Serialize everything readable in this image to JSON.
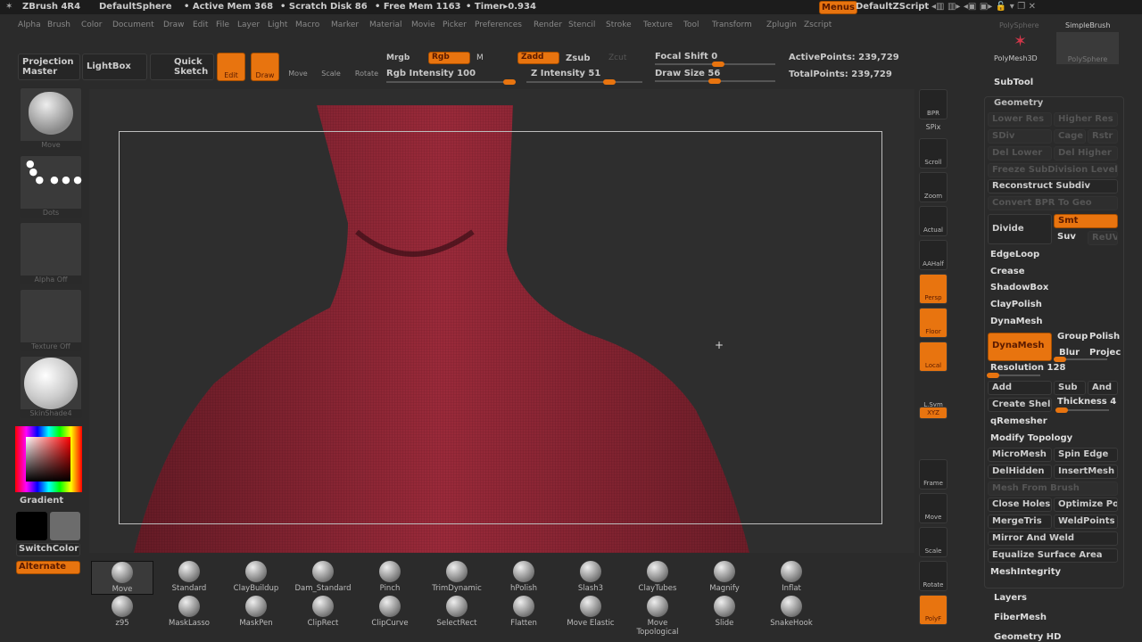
{
  "title": {
    "app": "ZBrush 4R4",
    "doc": "DefaultSphere",
    "active_mem": "• Active Mem 368",
    "scratch": "• Scratch Disk 86",
    "free_mem": "• Free Mem 1163",
    "timer": "• Timer▸0.934",
    "menus": "Menus",
    "script": "DefaultZScript"
  },
  "menu": [
    "Alpha",
    "Brush",
    "Color",
    "Document",
    "Draw",
    "Edit",
    "File",
    "Layer",
    "Light",
    "Macro",
    "Marker",
    "Material",
    "Movie",
    "Picker",
    "Preferences",
    "Render",
    "Stencil",
    "Stroke",
    "Texture",
    "Tool",
    "Transform",
    "Zplugin",
    "Zscript"
  ],
  "toolbar": {
    "projection_master": "Projection Master",
    "lightbox": "LightBox",
    "quick_sketch": "Quick Sketch",
    "edit": "Edit",
    "draw": "Draw",
    "move": "Move",
    "scale": "Scale",
    "rotate": "Rotate",
    "mrgb": "Mrgb",
    "rgb": "Rgb",
    "m": "M",
    "zadd": "Zadd",
    "zsub": "Zsub",
    "zcut": "Zcut",
    "rgb_intensity": "Rgb Intensity 100",
    "z_intensity": "Z Intensity 51",
    "focal_shift": "Focal Shift 0",
    "draw_size": "Draw Size 56",
    "active_points": "ActivePoints: 239,729",
    "total_points": "TotalPoints: 239,729",
    "rgb_intensity_value": 100,
    "z_intensity_value": 51,
    "focal_shift_value": 0,
    "draw_size_value": 56
  },
  "left": {
    "brush": "Move",
    "stroke": "Dots",
    "alpha": "Alpha  Off",
    "texture": "Texture  Off",
    "material": "SkinShade4",
    "gradient": "Gradient",
    "switch_color": "SwitchColor",
    "alternate": "Alternate"
  },
  "right_shelf": [
    "BPR",
    "SPix",
    "Scroll",
    "Zoom",
    "Actual",
    "AAHalf",
    "Persp",
    "Floor",
    "Local",
    "L.Sym",
    "XYZ",
    "Frame",
    "Move",
    "Scale",
    "Rotate",
    "PolyF"
  ],
  "brushes_row1": [
    "Move",
    "Standard",
    "ClayBuildup",
    "Dam_Standard",
    "Pinch",
    "TrimDynamic",
    "hPolish",
    "Slash3",
    "ClayTubes",
    "Magnify",
    "Inflat"
  ],
  "brushes_row2": [
    "z95",
    "MaskLasso",
    "MaskPen",
    "ClipRect",
    "ClipCurve",
    "SelectRect",
    "Flatten",
    "Move Elastic",
    "Move Topological",
    "Slide",
    "SnakeHook"
  ],
  "tool": {
    "polysphere_top": "PolySphere",
    "simplebrush": "SimpleBrush",
    "polymesh3d": "PolyMesh3D",
    "polysphere": "PolySphere",
    "subtool": "SubTool"
  },
  "geometry": {
    "header": "Geometry",
    "lower_res": "Lower Res",
    "higher_res": "Higher Res",
    "sdiv": "SDiv",
    "cage": "Cage",
    "rstr": "Rstr",
    "del_lower": "Del Lower",
    "del_higher": "Del Higher",
    "freeze": "Freeze SubDivision Levels",
    "reconstruct": "Reconstruct Subdiv",
    "convert_bpr": "Convert BPR To Geo",
    "divide": "Divide",
    "smt": "Smt",
    "suv": "Suv",
    "relax": "ReUV",
    "edgeloop": "EdgeLoop",
    "crease": "Crease",
    "shadowbox": "ShadowBox",
    "claypolish": "ClayPolish",
    "dynamesh_header": "DynaMesh",
    "dynamesh": "DynaMesh",
    "group": "Group",
    "polish": "Polish",
    "blur": "Blur",
    "project": "Projec",
    "resolution": "Resolution 128",
    "resolution_value": 128,
    "add": "Add",
    "sub": "Sub",
    "and": "And",
    "create_shell": "Create Shell",
    "thickness": "Thickness 4",
    "qremesher": "qRemesher",
    "modify_topology": "Modify Topology",
    "micromesh": "MicroMesh",
    "spin_edge": "Spin Edge",
    "delhidden": "DelHidden",
    "insertmesh": "InsertMesh",
    "mesh_from_brush": "Mesh From Brush",
    "close_holes": "Close Holes",
    "optimize": "Optimize Poi",
    "mergetris": "MergeTris",
    "weldpoints": "WeldPoints",
    "mirror_weld": "Mirror And Weld",
    "equalize": "Equalize Surface Area",
    "meshintegrity": "MeshIntegrity"
  },
  "subpanels": [
    "Layers",
    "FiberMesh",
    "Geometry HD"
  ],
  "colors": {
    "accent": "#e8740f",
    "mesh": "#9a2a3a"
  }
}
